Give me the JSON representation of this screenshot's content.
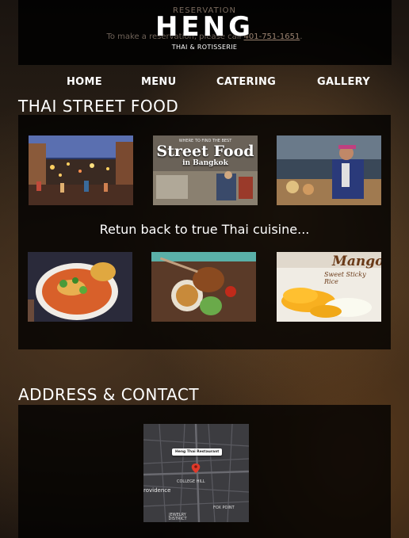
{
  "header": {
    "reservation_heading": "RESERVATION",
    "reservation_text": "To make a reservation, please call",
    "phone": "401-751-1651",
    "phone_suffix": ".",
    "logo": "HENG",
    "logo_sub": "THAI & ROTISSERIE"
  },
  "nav": {
    "items": [
      {
        "label": "HOME"
      },
      {
        "label": "MENU"
      },
      {
        "label": "CATERING"
      },
      {
        "label": "GALLERY"
      }
    ]
  },
  "street_food": {
    "title": "THAI STREET FOOD",
    "tagline": "Retun back to true Thai cuisine...",
    "photo2_caption_small": "WHERE TO FIND THE BEST",
    "photo2_caption_big": "Street Food",
    "photo2_caption_sub": "in Bangkok",
    "photo6_caption_big": "Mango",
    "photo6_caption_sub": "Sweet Sticky Rice"
  },
  "contact": {
    "title": "ADDRESS & CONTACT",
    "map_pin_label": "Heng Thai Restaurant",
    "map_labels": [
      "COLLEGE HILL",
      "rovidence",
      "FOX POINT",
      "JEWELRY DISTRICT"
    ]
  },
  "colors": {
    "panel_bg": "#000000",
    "accent_phone": "#9a8270",
    "text": "#ffffff"
  }
}
